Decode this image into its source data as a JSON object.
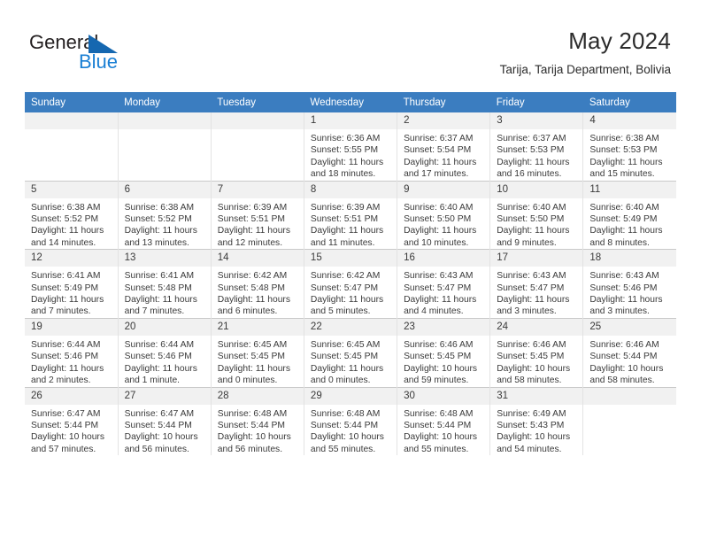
{
  "brand": {
    "name_top": "General",
    "name_bottom": "Blue",
    "triangle_color": "#1567b0",
    "blue_color": "#1a7fd4"
  },
  "header": {
    "title": "May 2024",
    "subtitle": "Tarija, Tarija Department, Bolivia"
  },
  "theme": {
    "header_bg": "#3b7dc0",
    "header_text": "#ffffff",
    "daynum_bg": "#f1f1f1",
    "cell_bg": "#ffffff",
    "grid_line": "#c9c9c9"
  },
  "calendar": {
    "columns": [
      "Sunday",
      "Monday",
      "Tuesday",
      "Wednesday",
      "Thursday",
      "Friday",
      "Saturday"
    ],
    "weeks": [
      [
        {
          "day": "",
          "lines": []
        },
        {
          "day": "",
          "lines": []
        },
        {
          "day": "",
          "lines": []
        },
        {
          "day": "1",
          "lines": [
            "Sunrise: 6:36 AM",
            "Sunset: 5:55 PM",
            "Daylight: 11 hours",
            "and 18 minutes."
          ]
        },
        {
          "day": "2",
          "lines": [
            "Sunrise: 6:37 AM",
            "Sunset: 5:54 PM",
            "Daylight: 11 hours",
            "and 17 minutes."
          ]
        },
        {
          "day": "3",
          "lines": [
            "Sunrise: 6:37 AM",
            "Sunset: 5:53 PM",
            "Daylight: 11 hours",
            "and 16 minutes."
          ]
        },
        {
          "day": "4",
          "lines": [
            "Sunrise: 6:38 AM",
            "Sunset: 5:53 PM",
            "Daylight: 11 hours",
            "and 15 minutes."
          ]
        }
      ],
      [
        {
          "day": "5",
          "lines": [
            "Sunrise: 6:38 AM",
            "Sunset: 5:52 PM",
            "Daylight: 11 hours",
            "and 14 minutes."
          ]
        },
        {
          "day": "6",
          "lines": [
            "Sunrise: 6:38 AM",
            "Sunset: 5:52 PM",
            "Daylight: 11 hours",
            "and 13 minutes."
          ]
        },
        {
          "day": "7",
          "lines": [
            "Sunrise: 6:39 AM",
            "Sunset: 5:51 PM",
            "Daylight: 11 hours",
            "and 12 minutes."
          ]
        },
        {
          "day": "8",
          "lines": [
            "Sunrise: 6:39 AM",
            "Sunset: 5:51 PM",
            "Daylight: 11 hours",
            "and 11 minutes."
          ]
        },
        {
          "day": "9",
          "lines": [
            "Sunrise: 6:40 AM",
            "Sunset: 5:50 PM",
            "Daylight: 11 hours",
            "and 10 minutes."
          ]
        },
        {
          "day": "10",
          "lines": [
            "Sunrise: 6:40 AM",
            "Sunset: 5:50 PM",
            "Daylight: 11 hours",
            "and 9 minutes."
          ]
        },
        {
          "day": "11",
          "lines": [
            "Sunrise: 6:40 AM",
            "Sunset: 5:49 PM",
            "Daylight: 11 hours",
            "and 8 minutes."
          ]
        }
      ],
      [
        {
          "day": "12",
          "lines": [
            "Sunrise: 6:41 AM",
            "Sunset: 5:49 PM",
            "Daylight: 11 hours",
            "and 7 minutes."
          ]
        },
        {
          "day": "13",
          "lines": [
            "Sunrise: 6:41 AM",
            "Sunset: 5:48 PM",
            "Daylight: 11 hours",
            "and 7 minutes."
          ]
        },
        {
          "day": "14",
          "lines": [
            "Sunrise: 6:42 AM",
            "Sunset: 5:48 PM",
            "Daylight: 11 hours",
            "and 6 minutes."
          ]
        },
        {
          "day": "15",
          "lines": [
            "Sunrise: 6:42 AM",
            "Sunset: 5:47 PM",
            "Daylight: 11 hours",
            "and 5 minutes."
          ]
        },
        {
          "day": "16",
          "lines": [
            "Sunrise: 6:43 AM",
            "Sunset: 5:47 PM",
            "Daylight: 11 hours",
            "and 4 minutes."
          ]
        },
        {
          "day": "17",
          "lines": [
            "Sunrise: 6:43 AM",
            "Sunset: 5:47 PM",
            "Daylight: 11 hours",
            "and 3 minutes."
          ]
        },
        {
          "day": "18",
          "lines": [
            "Sunrise: 6:43 AM",
            "Sunset: 5:46 PM",
            "Daylight: 11 hours",
            "and 3 minutes."
          ]
        }
      ],
      [
        {
          "day": "19",
          "lines": [
            "Sunrise: 6:44 AM",
            "Sunset: 5:46 PM",
            "Daylight: 11 hours",
            "and 2 minutes."
          ]
        },
        {
          "day": "20",
          "lines": [
            "Sunrise: 6:44 AM",
            "Sunset: 5:46 PM",
            "Daylight: 11 hours",
            "and 1 minute."
          ]
        },
        {
          "day": "21",
          "lines": [
            "Sunrise: 6:45 AM",
            "Sunset: 5:45 PM",
            "Daylight: 11 hours",
            "and 0 minutes."
          ]
        },
        {
          "day": "22",
          "lines": [
            "Sunrise: 6:45 AM",
            "Sunset: 5:45 PM",
            "Daylight: 11 hours",
            "and 0 minutes."
          ]
        },
        {
          "day": "23",
          "lines": [
            "Sunrise: 6:46 AM",
            "Sunset: 5:45 PM",
            "Daylight: 10 hours",
            "and 59 minutes."
          ]
        },
        {
          "day": "24",
          "lines": [
            "Sunrise: 6:46 AM",
            "Sunset: 5:45 PM",
            "Daylight: 10 hours",
            "and 58 minutes."
          ]
        },
        {
          "day": "25",
          "lines": [
            "Sunrise: 6:46 AM",
            "Sunset: 5:44 PM",
            "Daylight: 10 hours",
            "and 58 minutes."
          ]
        }
      ],
      [
        {
          "day": "26",
          "lines": [
            "Sunrise: 6:47 AM",
            "Sunset: 5:44 PM",
            "Daylight: 10 hours",
            "and 57 minutes."
          ]
        },
        {
          "day": "27",
          "lines": [
            "Sunrise: 6:47 AM",
            "Sunset: 5:44 PM",
            "Daylight: 10 hours",
            "and 56 minutes."
          ]
        },
        {
          "day": "28",
          "lines": [
            "Sunrise: 6:48 AM",
            "Sunset: 5:44 PM",
            "Daylight: 10 hours",
            "and 56 minutes."
          ]
        },
        {
          "day": "29",
          "lines": [
            "Sunrise: 6:48 AM",
            "Sunset: 5:44 PM",
            "Daylight: 10 hours",
            "and 55 minutes."
          ]
        },
        {
          "day": "30",
          "lines": [
            "Sunrise: 6:48 AM",
            "Sunset: 5:44 PM",
            "Daylight: 10 hours",
            "and 55 minutes."
          ]
        },
        {
          "day": "31",
          "lines": [
            "Sunrise: 6:49 AM",
            "Sunset: 5:43 PM",
            "Daylight: 10 hours",
            "and 54 minutes."
          ]
        },
        {
          "day": "",
          "lines": []
        }
      ]
    ]
  }
}
